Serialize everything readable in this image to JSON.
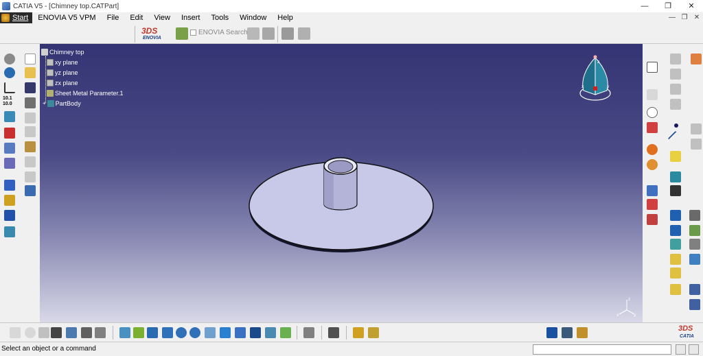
{
  "window": {
    "title": "CATIA V5 - [Chimney top.CATPart]",
    "controls": [
      "—",
      "❐",
      "✕"
    ]
  },
  "menu": {
    "start": "Start",
    "items": [
      "ENOVIA V5 VPM",
      "File",
      "Edit",
      "View",
      "Insert",
      "Tools",
      "Window",
      "Help"
    ],
    "doc_controls": [
      "—",
      "❐",
      "✕"
    ]
  },
  "toolbar": {
    "enovia_logo_ds": "3DS",
    "enovia_logo_text": "ENOVIA",
    "enovia_search": "ENOVIA Search..."
  },
  "tree": {
    "root": "Chimney top",
    "items": [
      "xy plane",
      "yz plane",
      "zx plane",
      "Sheet Metal Parameter.1",
      "PartBody"
    ]
  },
  "left_toolbar": {
    "measure_text": "10.1\n10.0"
  },
  "compass": {
    "x": "x",
    "y": "y",
    "z": "z"
  },
  "axis": {
    "x": "x",
    "y": "y",
    "z": "z"
  },
  "status": {
    "message": "Select an object or a command",
    "command_value": ""
  },
  "catia_logo": {
    "ds": "3DS",
    "text": "CATIA"
  },
  "colors": {
    "viewport_top": "#343474",
    "viewport_bottom": "#d8d8e8",
    "part_fill": "#c8c8e8",
    "part_edge": "#111111"
  }
}
